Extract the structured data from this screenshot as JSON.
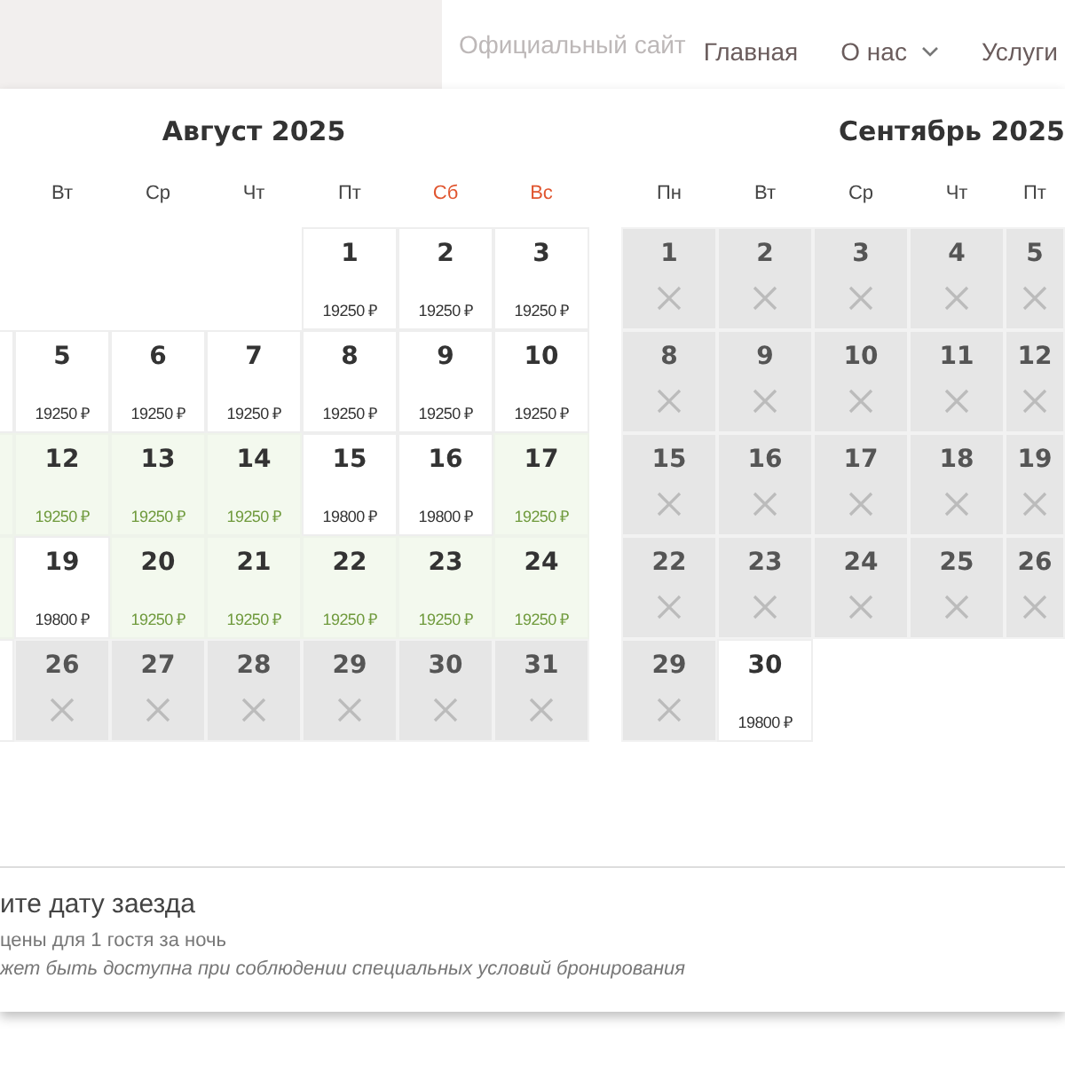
{
  "header": {
    "site_title": "Официальный сайт",
    "nav": [
      {
        "label": "Главная",
        "dropdown": false
      },
      {
        "label": "О нас",
        "dropdown": true
      },
      {
        "label": "Услуги",
        "dropdown": false
      }
    ]
  },
  "calendar": {
    "months": [
      {
        "title": "Август 2025",
        "weekdays": [
          {
            "label": "Вт",
            "weekend": false
          },
          {
            "label": "Ср",
            "weekend": false
          },
          {
            "label": "Чт",
            "weekend": false
          },
          {
            "label": "Пт",
            "weekend": false
          },
          {
            "label": "Сб",
            "weekend": true
          },
          {
            "label": "Вс",
            "weekend": true
          }
        ],
        "weeks": [
          {
            "days": [
              {
                "kind": "blank"
              },
              {
                "kind": "blank"
              },
              {
                "kind": "blank"
              },
              {
                "kind": "blank"
              },
              {
                "kind": "day",
                "day": "1",
                "price": "19250 ₽",
                "special": false,
                "closed": false
              },
              {
                "kind": "day",
                "day": "2",
                "price": "19250 ₽",
                "special": false,
                "closed": false
              },
              {
                "kind": "day",
                "day": "3",
                "price": "19250 ₽",
                "special": false,
                "closed": false
              }
            ]
          },
          {
            "days": [
              {
                "kind": "clipped",
                "special": false
              },
              {
                "kind": "day",
                "day": "5",
                "price": "19250 ₽",
                "special": false,
                "closed": false
              },
              {
                "kind": "day",
                "day": "6",
                "price": "19250 ₽",
                "special": false,
                "closed": false
              },
              {
                "kind": "day",
                "day": "7",
                "price": "19250 ₽",
                "special": false,
                "closed": false
              },
              {
                "kind": "day",
                "day": "8",
                "price": "19250 ₽",
                "special": false,
                "closed": false
              },
              {
                "kind": "day",
                "day": "9",
                "price": "19250 ₽",
                "special": false,
                "closed": false
              },
              {
                "kind": "day",
                "day": "10",
                "price": "19250 ₽",
                "special": false,
                "closed": false
              }
            ]
          },
          {
            "days": [
              {
                "kind": "clipped",
                "special": true
              },
              {
                "kind": "day",
                "day": "12",
                "price": "19250 ₽",
                "special": true,
                "closed": false
              },
              {
                "kind": "day",
                "day": "13",
                "price": "19250 ₽",
                "special": true,
                "closed": false
              },
              {
                "kind": "day",
                "day": "14",
                "price": "19250 ₽",
                "special": true,
                "closed": false
              },
              {
                "kind": "day",
                "day": "15",
                "price": "19800 ₽",
                "special": false,
                "closed": false
              },
              {
                "kind": "day",
                "day": "16",
                "price": "19800 ₽",
                "special": false,
                "closed": false
              },
              {
                "kind": "day",
                "day": "17",
                "price": "19250 ₽",
                "special": true,
                "closed": false
              }
            ]
          },
          {
            "days": [
              {
                "kind": "clipped",
                "special": true
              },
              {
                "kind": "day",
                "day": "19",
                "price": "19800 ₽",
                "special": false,
                "closed": false
              },
              {
                "kind": "day",
                "day": "20",
                "price": "19250 ₽",
                "special": true,
                "closed": false
              },
              {
                "kind": "day",
                "day": "21",
                "price": "19250 ₽",
                "special": true,
                "closed": false
              },
              {
                "kind": "day",
                "day": "22",
                "price": "19250 ₽",
                "special": true,
                "closed": false
              },
              {
                "kind": "day",
                "day": "23",
                "price": "19250 ₽",
                "special": true,
                "closed": false
              },
              {
                "kind": "day",
                "day": "24",
                "price": "19250 ₽",
                "special": true,
                "closed": false
              }
            ]
          },
          {
            "days": [
              {
                "kind": "clipped",
                "special": false
              },
              {
                "kind": "day",
                "day": "26",
                "closed": true
              },
              {
                "kind": "day",
                "day": "27",
                "closed": true
              },
              {
                "kind": "day",
                "day": "28",
                "closed": true
              },
              {
                "kind": "day",
                "day": "29",
                "closed": true
              },
              {
                "kind": "day",
                "day": "30",
                "closed": true
              },
              {
                "kind": "day",
                "day": "31",
                "closed": true
              }
            ]
          }
        ]
      },
      {
        "title": "Сентябрь 2025",
        "weekdays": [
          {
            "label": "Пн",
            "weekend": false
          },
          {
            "label": "Вт",
            "weekend": false
          },
          {
            "label": "Ср",
            "weekend": false
          },
          {
            "label": "Чт",
            "weekend": false
          },
          {
            "label": "Пт",
            "weekend": false
          }
        ],
        "weeks": [
          {
            "days": [
              {
                "kind": "day",
                "day": "1",
                "closed": true
              },
              {
                "kind": "day",
                "day": "2",
                "closed": true
              },
              {
                "kind": "day",
                "day": "3",
                "closed": true
              },
              {
                "kind": "day",
                "day": "4",
                "closed": true
              },
              {
                "kind": "day",
                "day": "5",
                "closed": true
              }
            ]
          },
          {
            "days": [
              {
                "kind": "day",
                "day": "8",
                "closed": true
              },
              {
                "kind": "day",
                "day": "9",
                "closed": true
              },
              {
                "kind": "day",
                "day": "10",
                "closed": true
              },
              {
                "kind": "day",
                "day": "11",
                "closed": true
              },
              {
                "kind": "day",
                "day": "12",
                "closed": true
              }
            ]
          },
          {
            "days": [
              {
                "kind": "day",
                "day": "15",
                "closed": true
              },
              {
                "kind": "day",
                "day": "16",
                "closed": true
              },
              {
                "kind": "day",
                "day": "17",
                "closed": true
              },
              {
                "kind": "day",
                "day": "18",
                "closed": true
              },
              {
                "kind": "day",
                "day": "19",
                "closed": true
              }
            ]
          },
          {
            "days": [
              {
                "kind": "day",
                "day": "22",
                "closed": true
              },
              {
                "kind": "day",
                "day": "23",
                "closed": true
              },
              {
                "kind": "day",
                "day": "24",
                "closed": true
              },
              {
                "kind": "day",
                "day": "25",
                "closed": true
              },
              {
                "kind": "day",
                "day": "26",
                "closed": true
              }
            ]
          },
          {
            "days": [
              {
                "kind": "day",
                "day": "29",
                "closed": true
              },
              {
                "kind": "day",
                "day": "30",
                "price": "19800 ₽",
                "special": false,
                "closed": false
              }
            ]
          }
        ]
      }
    ]
  },
  "footer": {
    "heading": "ите дату заезда",
    "note": "цены для 1 гостя за ночь",
    "disclaimer": "жет быть доступна при соблюдении специальных условий бронирования"
  }
}
